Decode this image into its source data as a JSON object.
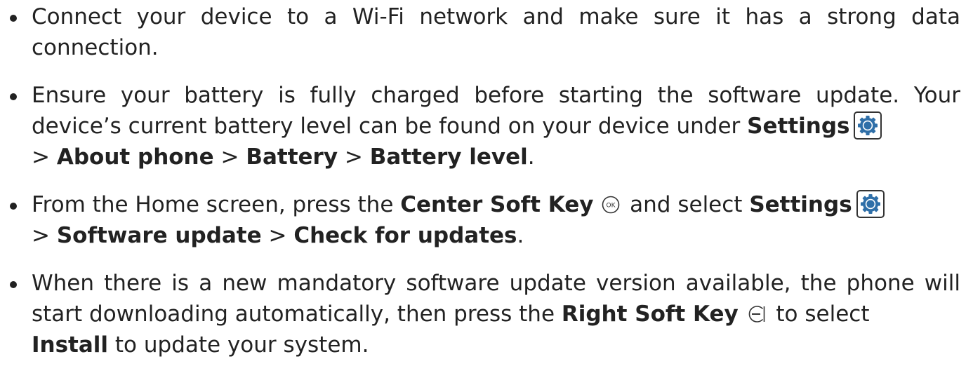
{
  "items": [
    {
      "text": "Connect your device to a Wi-Fi network and make sure it has a strong data connection."
    },
    {
      "part1": "Ensure your battery is fully charged before starting the software update. Your device’s current battery level can be found on your device under ",
      "b_settings": "Settings",
      "sep1": " > ",
      "b_about": "About phone",
      "sep2": " > ",
      "b_battery": "Battery",
      "sep3": " > ",
      "b_level": "Battery level",
      "end": "."
    },
    {
      "part1": "From the Home screen, press the ",
      "b_center": "Center Soft Key",
      "ok_label": "OK",
      "part2": " and select ",
      "b_settings": "Settings",
      "sep1": " > ",
      "b_software": "Software update",
      "sep2": " > ",
      "b_check": "Check for updates",
      "end": "."
    },
    {
      "part1": "When there is a new mandatory software update version available, the phone will start downloading automatically, then press the ",
      "b_right": "Right Soft Key",
      "part2": " to select ",
      "b_install": "Install",
      "part3": " to update your system."
    }
  ],
  "icons": {
    "settings": "settings-gear-icon",
    "center_key": "ok-key-icon",
    "right_key": "right-soft-key-icon",
    "accent_color": "#2f6fa8"
  }
}
